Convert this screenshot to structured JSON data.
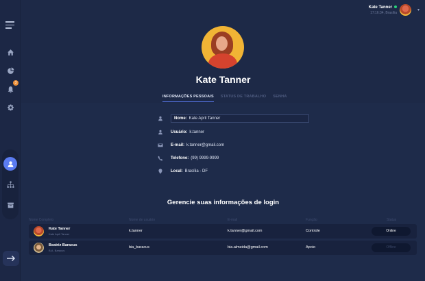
{
  "header": {
    "user_name": "Kate Tanner",
    "user_time": "17:16:34, Brasília"
  },
  "profile": {
    "name": "Kate Tanner",
    "tabs": [
      "INFORMAÇÕES PESSOAIS",
      "STATUS DE TRABALHO",
      "SENHA"
    ]
  },
  "details": {
    "name_label": "Nome:",
    "name_value": "Kate April Tanner",
    "user_label": "Usuário:",
    "user_value": "k.tanner",
    "email_label": "E-mail:",
    "email_value": "k.tanner@gmail.com",
    "phone_label": "Telefone:",
    "phone_value": "(99) 9999-9999",
    "local_label": "Local:",
    "local_value": "Brasília - DF"
  },
  "sidebar": {
    "notification_count": "3"
  },
  "login": {
    "title": "Gerencie suas informações de login",
    "columns": [
      "Nome Completo",
      "Nome de usuário",
      "E-mail",
      "Função",
      "Status"
    ],
    "rows": [
      {
        "name": "Kate Tanner",
        "subname": "Kate April Tanner",
        "username": "k.tanner",
        "email": "k.tanner@gmail.com",
        "role": "Controle",
        "status": "Online"
      },
      {
        "name": "Beatriz Baracus",
        "subname": "B.A. Baracus",
        "username": "bia_baracus",
        "email": "bia.almeida@gmail.com",
        "role": "Apoio",
        "status": "Offline"
      }
    ]
  },
  "colors": {
    "accent": "#5b7cf2",
    "online": "#27d07a",
    "badge": "#f0923a",
    "background": "#1e2b4a"
  }
}
